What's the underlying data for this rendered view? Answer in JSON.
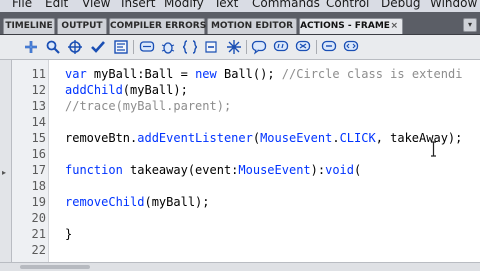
{
  "menu": [
    "File",
    "Edit",
    "View",
    "Insert",
    "Modify",
    "Text",
    "Commands",
    "Control",
    "Debug",
    "Window"
  ],
  "tabs": [
    {
      "label": "TIMELINE",
      "active": false
    },
    {
      "label": "OUTPUT",
      "active": false
    },
    {
      "label": "COMPILER ERRORS",
      "active": false
    },
    {
      "label": "MOTION EDITOR",
      "active": false
    },
    {
      "label": "ACTIONS - FRAME",
      "active": true
    }
  ],
  "tab_close_glyph": "×",
  "tab_menu_glyph": "▾",
  "toolbar_icons": [
    "add-statement-icon",
    "find-icon",
    "target-path-icon",
    "check-syntax-icon",
    "auto-format-icon",
    "code-hint-icon",
    "debug-options-icon",
    "collapse-between-braces-icon",
    "collapse-selection-icon",
    "expand-all-icon",
    "apply-block-comment-icon",
    "apply-line-comment-icon",
    "remove-comment-icon",
    "show-toolbox-icon",
    "code-snippets-icon"
  ],
  "code": {
    "line_numbers": [
      "11",
      "12",
      "13",
      "14",
      "15",
      "16",
      "17",
      "18",
      "19",
      "20",
      "21",
      "22"
    ],
    "lines": [
      {
        "segments": [
          {
            "t": "var",
            "c": "kw"
          },
          {
            "t": " myBall:",
            "c": ""
          },
          {
            "t": "Ball",
            "c": ""
          },
          {
            "t": " = ",
            "c": ""
          },
          {
            "t": "new",
            "c": "kw"
          },
          {
            "t": " Ball(); ",
            "c": ""
          },
          {
            "t": "//Circle class is extendi",
            "c": "cm"
          }
        ]
      },
      {
        "segments": [
          {
            "t": "addChild",
            "c": "fn"
          },
          {
            "t": "(myBall);",
            "c": ""
          }
        ]
      },
      {
        "segments": [
          {
            "t": "//trace(myBall.parent);",
            "c": "cm"
          }
        ]
      },
      {
        "segments": []
      },
      {
        "segments": [
          {
            "t": "removeBtn.",
            "c": ""
          },
          {
            "t": "addEventListener",
            "c": "fn"
          },
          {
            "t": "(",
            "c": ""
          },
          {
            "t": "MouseEvent",
            "c": "ty"
          },
          {
            "t": ".",
            "c": ""
          },
          {
            "t": "CLICK",
            "c": "ty"
          },
          {
            "t": ", takeAway);",
            "c": ""
          }
        ]
      },
      {
        "segments": []
      },
      {
        "segments": [
          {
            "t": "function",
            "c": "kw"
          },
          {
            "t": " takeaway(event:",
            "c": ""
          },
          {
            "t": "MouseEvent",
            "c": "ty"
          },
          {
            "t": "):",
            "c": ""
          },
          {
            "t": "void",
            "c": "kw"
          },
          {
            "t": "(",
            "c": ""
          }
        ]
      },
      {
        "segments": []
      },
      {
        "segments": [
          {
            "t": "removeChild",
            "c": "fn"
          },
          {
            "t": "(myBall);",
            "c": ""
          }
        ]
      },
      {
        "segments": []
      },
      {
        "segments": [
          {
            "t": "}",
            "c": ""
          }
        ]
      },
      {
        "segments": []
      }
    ]
  },
  "colors": {
    "keyword": "#0033ff",
    "comment": "#8d8d8d",
    "tab_bar": "#5b5e66",
    "editor_bg": "#ffffff"
  }
}
